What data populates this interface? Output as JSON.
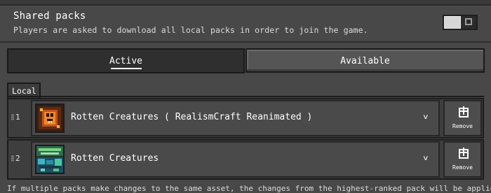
{
  "shared_packs": {
    "title": "Shared packs",
    "description": "Players are asked to download all local packs in order to join the game.",
    "toggle_state": "off"
  },
  "tabs": [
    {
      "label": "Active",
      "selected": true
    },
    {
      "label": "Available",
      "selected": false
    }
  ],
  "local_group": {
    "label": "Local",
    "packs": [
      {
        "rank": "1",
        "name": "Rotten Creatures ( RealismCraft Reanimated )",
        "icon": "rotten-creatures-reanimated-icon",
        "remove_label": "Remove"
      },
      {
        "rank": "2",
        "name": "Rotten Creatures",
        "icon": "rotten-creatures-icon",
        "remove_label": "Remove"
      }
    ]
  },
  "footer_note": "If multiple packs make changes to the same asset, the changes from the highest-ranked pack will be applied.",
  "colors": {
    "background": "#484848",
    "tab_active": "#2f2f2f",
    "tab_inactive": "#555555",
    "row_background": "#3e3e3e"
  }
}
